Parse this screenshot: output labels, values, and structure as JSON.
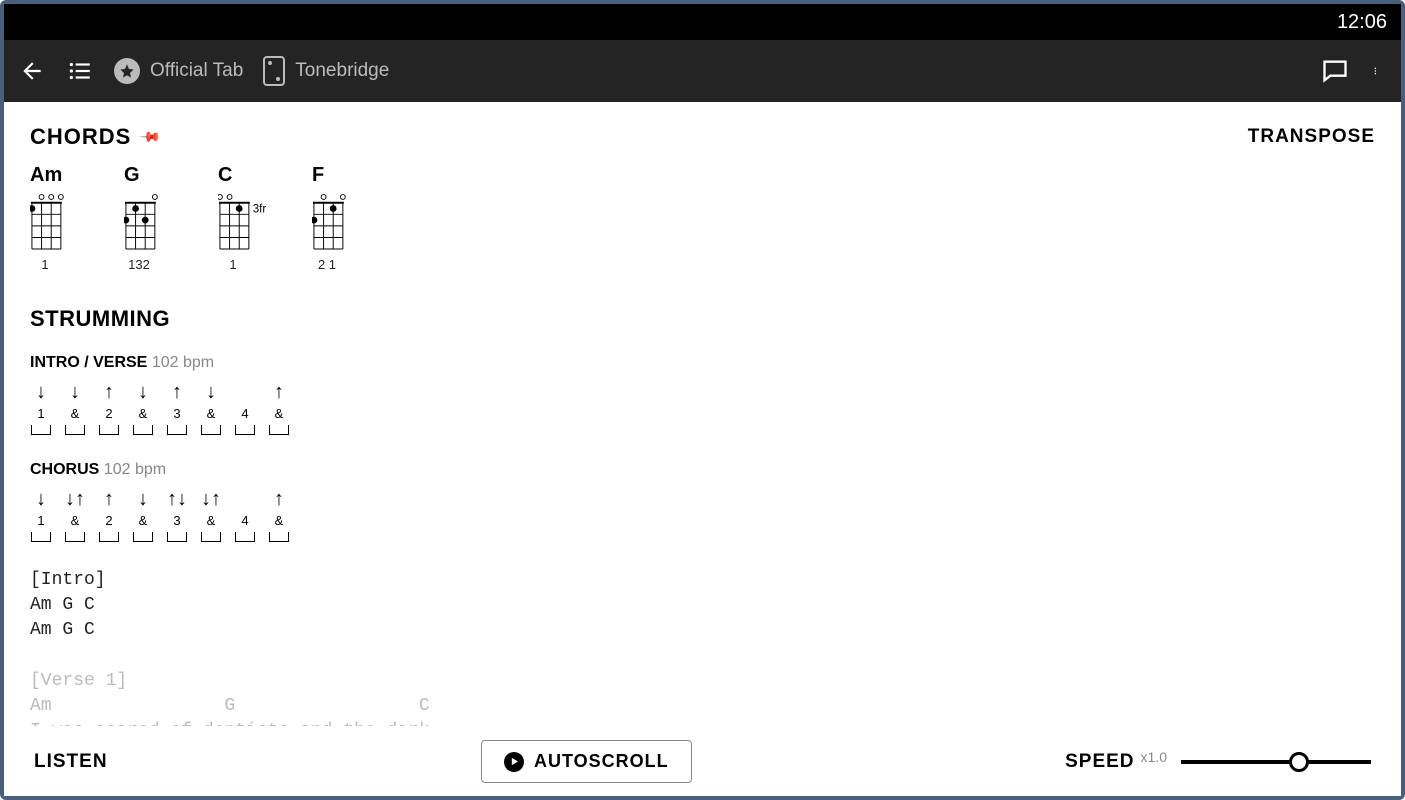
{
  "status": {
    "time": "12:06"
  },
  "toolbar": {
    "official_tab": "Official Tab",
    "tonebridge": "Tonebridge"
  },
  "chords": {
    "title": "CHORDS",
    "transpose": "TRANSPOSE",
    "list": [
      {
        "name": "Am",
        "fingers": "1",
        "fret_label": "",
        "open": [
          false,
          true,
          true,
          true
        ],
        "dots": [
          [
            0,
            0
          ]
        ]
      },
      {
        "name": "G",
        "fingers": "132",
        "fret_label": "",
        "open": [
          false,
          false,
          false,
          true
        ],
        "dots": [
          [
            0,
            1
          ],
          [
            1,
            0
          ],
          [
            2,
            1
          ]
        ]
      },
      {
        "name": "C",
        "fingers": "1",
        "fret_label": "3fr",
        "open": [
          true,
          true,
          false,
          false
        ],
        "dots": [
          [
            2,
            0
          ]
        ]
      },
      {
        "name": "F",
        "fingers": "2 1",
        "fret_label": "",
        "open": [
          false,
          true,
          false,
          true
        ],
        "dots": [
          [
            0,
            1
          ],
          [
            2,
            0
          ]
        ]
      }
    ]
  },
  "strumming": {
    "title": "STRUMMING",
    "patterns": [
      {
        "label": "INTRO / VERSE",
        "bpm": "102 bpm",
        "beats": [
          {
            "n": "1",
            "a": "d"
          },
          {
            "n": "&",
            "a": "d"
          },
          {
            "n": "2",
            "a": "u"
          },
          {
            "n": "&",
            "a": "d"
          },
          {
            "n": "3",
            "a": "u"
          },
          {
            "n": "&",
            "a": "d"
          },
          {
            "n": "4",
            "a": ""
          },
          {
            "n": "&",
            "a": "u"
          }
        ],
        "extra_after_3": "d",
        "extra_after_8": [
          "d",
          "u"
        ]
      },
      {
        "label": "CHORUS",
        "bpm": "102 bpm",
        "beats": [
          {
            "n": "1",
            "a": "d"
          },
          {
            "n": "&",
            "a": "du"
          },
          {
            "n": "2",
            "a": "u"
          },
          {
            "n": "&",
            "a": "d"
          },
          {
            "n": "3",
            "a": "ud"
          },
          {
            "n": "&",
            "a": "du"
          },
          {
            "n": "4",
            "a": ""
          },
          {
            "n": "&",
            "a": "u"
          }
        ],
        "extra_after_8": [
          "d",
          "u"
        ]
      }
    ]
  },
  "tab": {
    "lines": [
      "[Intro]",
      "Am G C",
      "Am G C",
      "",
      "[Verse 1]",
      "Am                G                 C",
      "I was scared of dentists and the dark"
    ]
  },
  "bottom": {
    "listen": "LISTEN",
    "autoscroll": "AUTOSCROLL",
    "speed_label": "SPEED",
    "speed_mult": "x1.0",
    "slider_pos": 0.62
  }
}
